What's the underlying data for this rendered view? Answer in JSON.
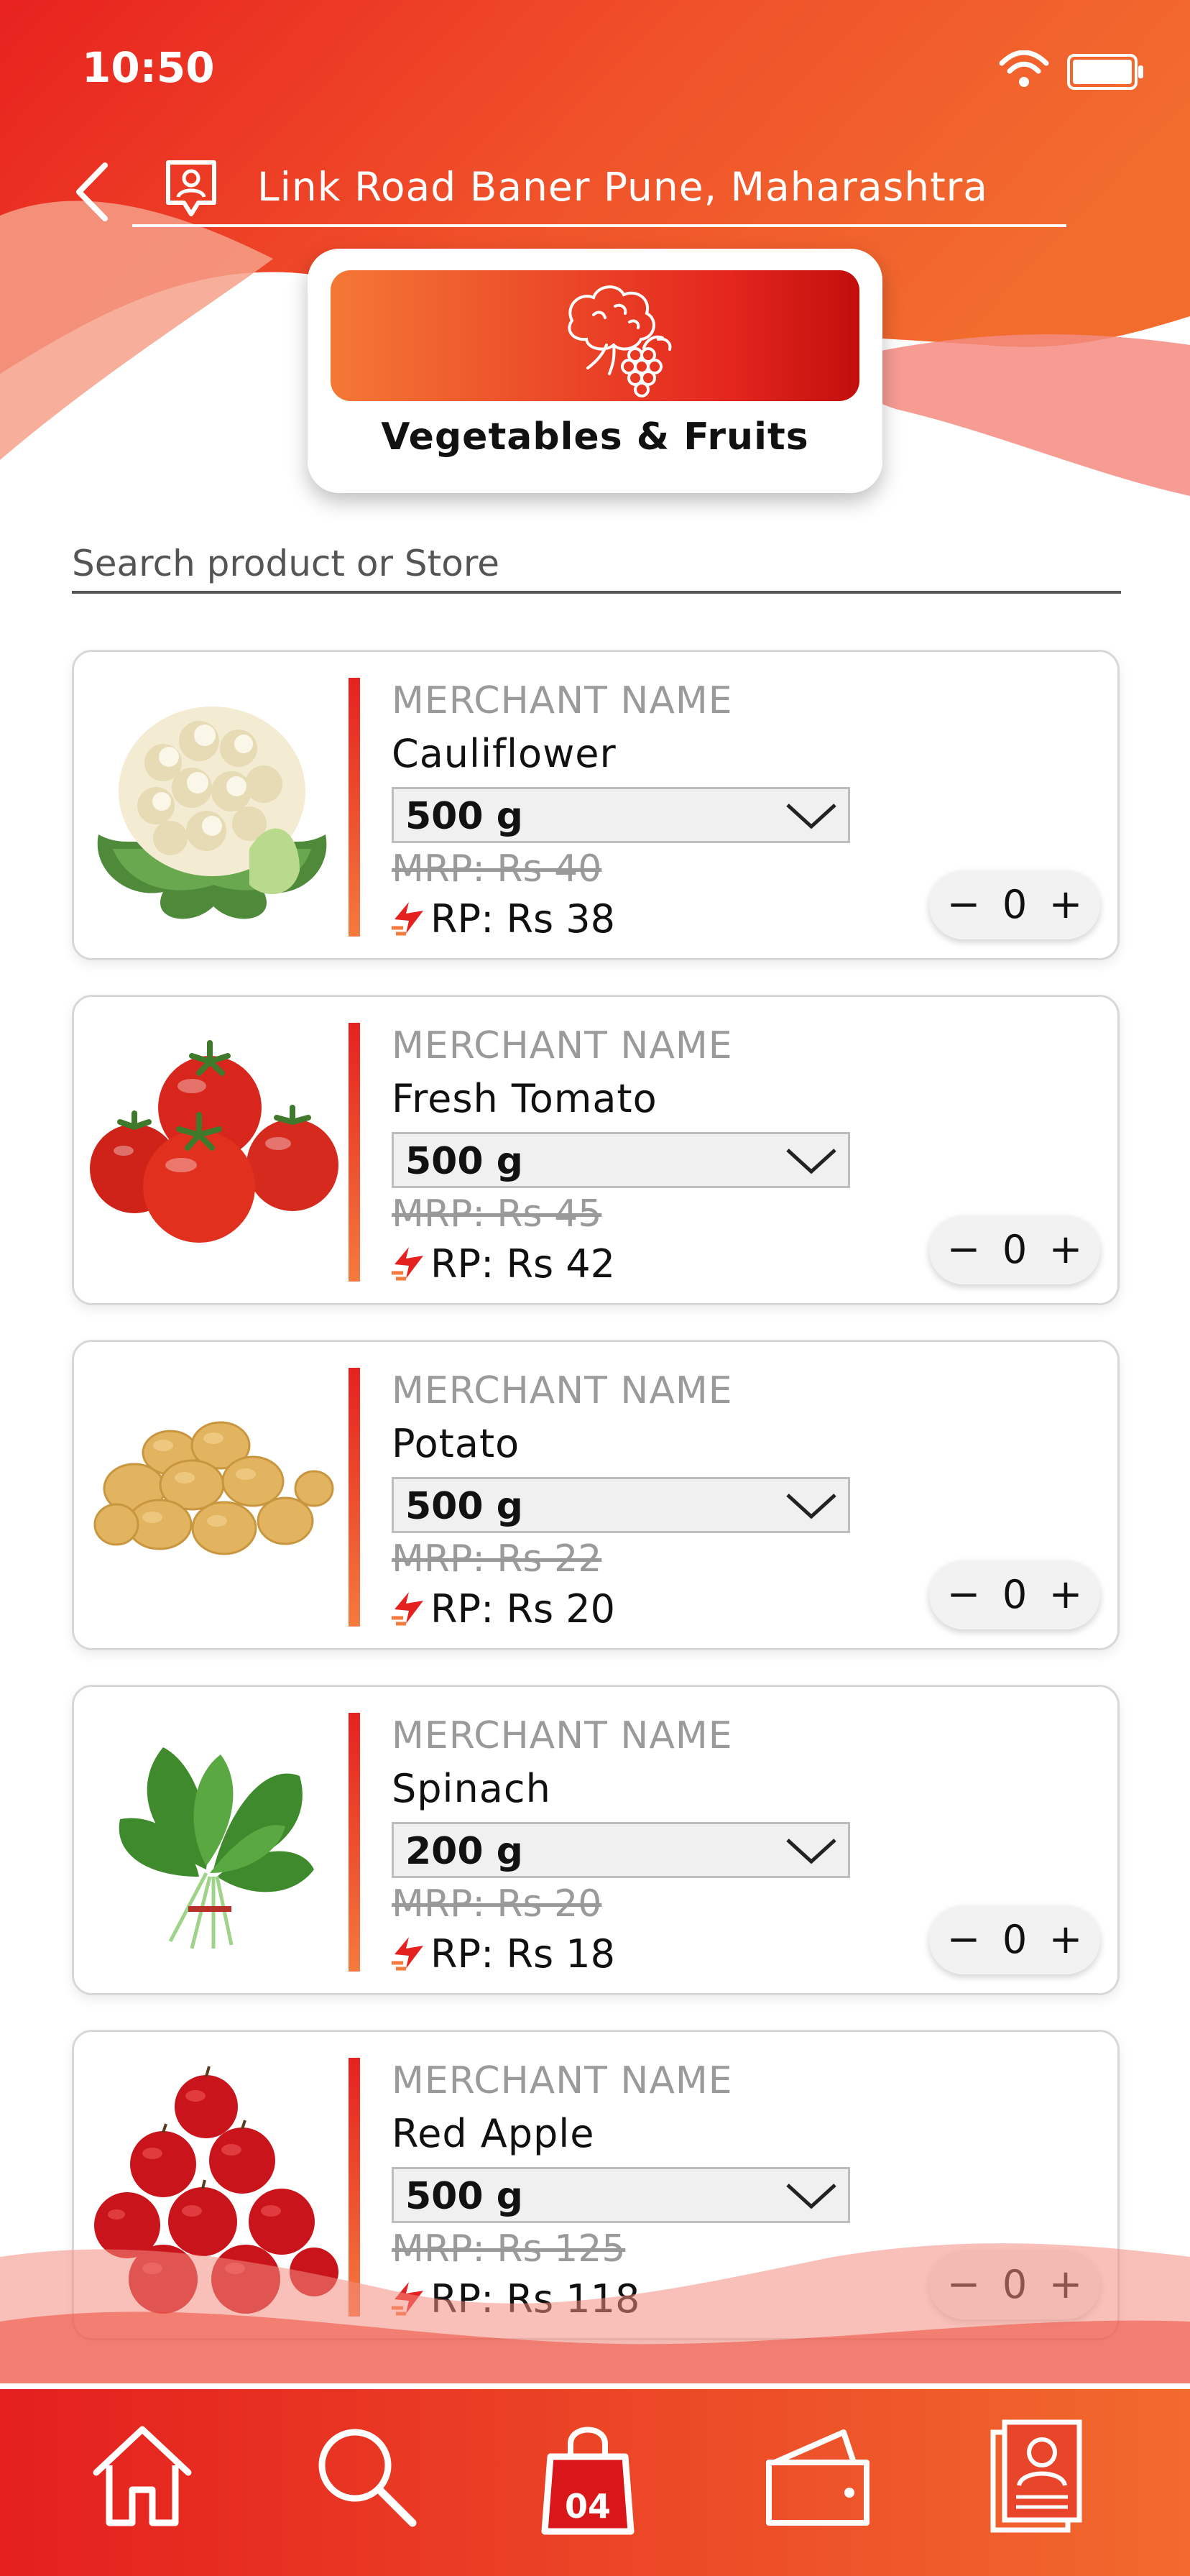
{
  "status_bar": {
    "time": "10:50"
  },
  "header": {
    "location": "Link Road Baner Pune, Maharashtra",
    "category": "Vegetables & Fruits"
  },
  "search": {
    "placeholder": "Search product or Store"
  },
  "products": [
    {
      "merchant": "MERCHANT NAME",
      "name": "Cauliflower",
      "weight": "500 g",
      "mrp": "MRP: Rs 40",
      "rp": "RP: Rs 38",
      "qty": "0",
      "image_icon": "cauliflower-image"
    },
    {
      "merchant": "MERCHANT NAME",
      "name": "Fresh Tomato",
      "weight": "500 g",
      "mrp": "MRP: Rs 45",
      "rp": "RP: Rs 42",
      "qty": "0",
      "image_icon": "tomato-image"
    },
    {
      "merchant": "MERCHANT NAME",
      "name": "Potato",
      "weight": "500 g",
      "mrp": "MRP: Rs 22",
      "rp": "RP: Rs 20",
      "qty": "0",
      "image_icon": "potato-image"
    },
    {
      "merchant": "MERCHANT NAME",
      "name": "Spinach",
      "weight": "200 g",
      "mrp": "MRP: Rs 20",
      "rp": "RP: Rs 18",
      "qty": "0",
      "image_icon": "spinach-image"
    },
    {
      "merchant": "MERCHANT NAME",
      "name": "Red Apple",
      "weight": "500 g",
      "mrp": "MRP: Rs 125",
      "rp": "RP: Rs 118",
      "qty": "0",
      "image_icon": "apple-image"
    }
  ],
  "stepper": {
    "minus": "−",
    "plus": "+"
  },
  "bottom_nav": {
    "items": [
      "home-icon",
      "search-icon",
      "cart-bag-icon",
      "wallet-icon",
      "profile-icon"
    ],
    "cart_count": "04"
  },
  "colors": {
    "accent_red": "#e5211f",
    "accent_orange": "#f57a3e",
    "deep_red": "#c20f0c"
  }
}
